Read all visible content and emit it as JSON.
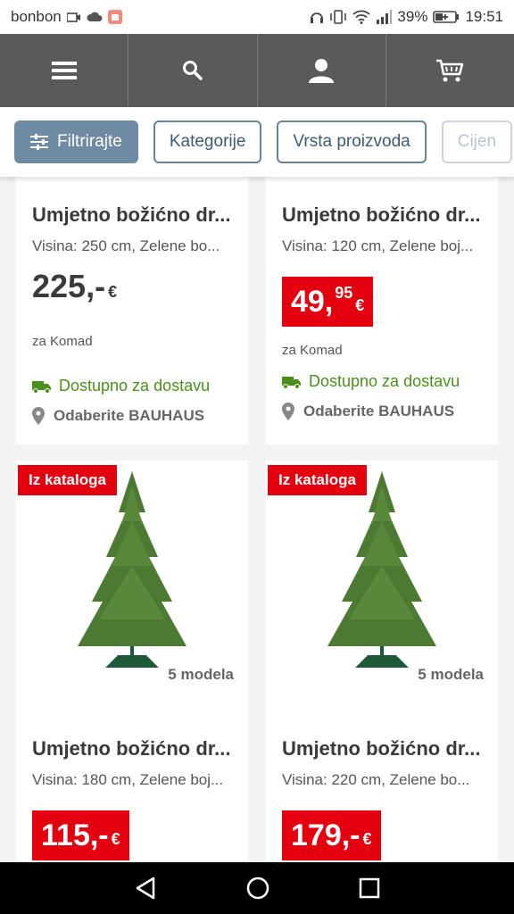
{
  "status": {
    "carrier": "bonbon",
    "battery": "39%",
    "time": "19:51"
  },
  "filters": [
    {
      "label": "Filtrirajte"
    },
    {
      "label": "Kategorije"
    },
    {
      "label": "Vrsta proizvoda"
    },
    {
      "label": "Cijen"
    }
  ],
  "products": [
    {
      "title": "Umjetno božićno dr...",
      "subtitle": "Visina: 250 cm, Zelene bo...",
      "price_main": "225,-",
      "currency": "€",
      "unit": "za Komad",
      "availability": "Dostupno za dostavu",
      "store": "Odaberite BAUHAUS"
    },
    {
      "title": "Umjetno božićno dr...",
      "subtitle": "Visina: 120 cm, Zelene boj...",
      "price_main": "49,",
      "price_cents": "95",
      "currency": "€",
      "unit": "za Komad",
      "availability": "Dostupno za dostavu",
      "store": "Odaberite BAUHAUS"
    },
    {
      "badge": "Iz kataloga",
      "models": "5  modela",
      "title": "Umjetno božićno dr...",
      "subtitle": "Visina: 180 cm, Zelene boj...",
      "price_main": "115,-",
      "currency": "€"
    },
    {
      "badge": "Iz kataloga",
      "models": "5  modela",
      "title": "Umjetno božićno dr...",
      "subtitle": "Visina: 220 cm, Zelene bo...",
      "price_main": "179,-",
      "currency": "€"
    }
  ],
  "colors": {
    "accent_red": "#e3000f",
    "nav_gray": "#5a5a5a",
    "available_green": "#4a8f1c",
    "filter_blue": "#6f8aa3"
  }
}
